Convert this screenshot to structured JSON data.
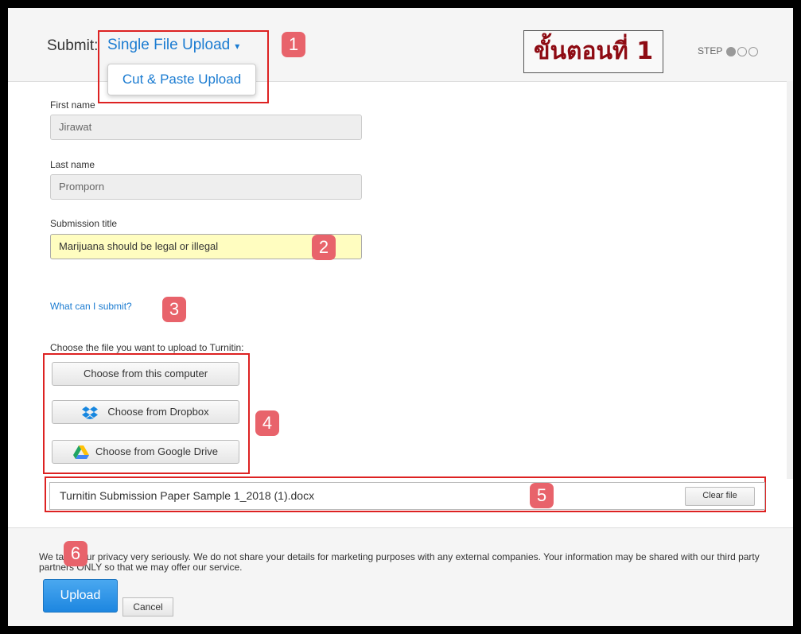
{
  "header": {
    "title": "Submit:",
    "mode_selected": "Single File Upload",
    "mode_caret": "▾",
    "dropdown_option": "Cut & Paste Upload",
    "thai_step": "ขั้นตอนที่ 1",
    "step_label": "STEP"
  },
  "badges": [
    "1",
    "2",
    "3",
    "4",
    "5",
    "6"
  ],
  "form": {
    "first_name_label": "First name",
    "first_name_value": "Jirawat",
    "last_name_label": "Last name",
    "last_name_value": "Promporn",
    "submission_title_label": "Submission title",
    "submission_title_value": "Marijuana should be legal or illegal",
    "help_link": "What can I submit?",
    "choose_label": "Choose the file you want to upload to Turnitin:",
    "btn_computer": "Choose from this computer",
    "btn_dropbox": "Choose from Dropbox",
    "btn_drive": "Choose from Google Drive",
    "file_name": "Turnitin Submission Paper Sample 1_2018 (1).docx",
    "clear_file": "Clear file"
  },
  "footer": {
    "privacy_text": "We take your privacy very seriously. We do not share your details for marketing purposes with any external companies. Your information may be shared with our third party partners ONLY so that we may offer our service.",
    "upload_label": "Upload",
    "cancel_label": "Cancel"
  },
  "colors": {
    "accent": "#1a7bd1",
    "highlight_box": "#dd2222",
    "badge": "#e8636b",
    "thai_text": "#8e0b13"
  }
}
